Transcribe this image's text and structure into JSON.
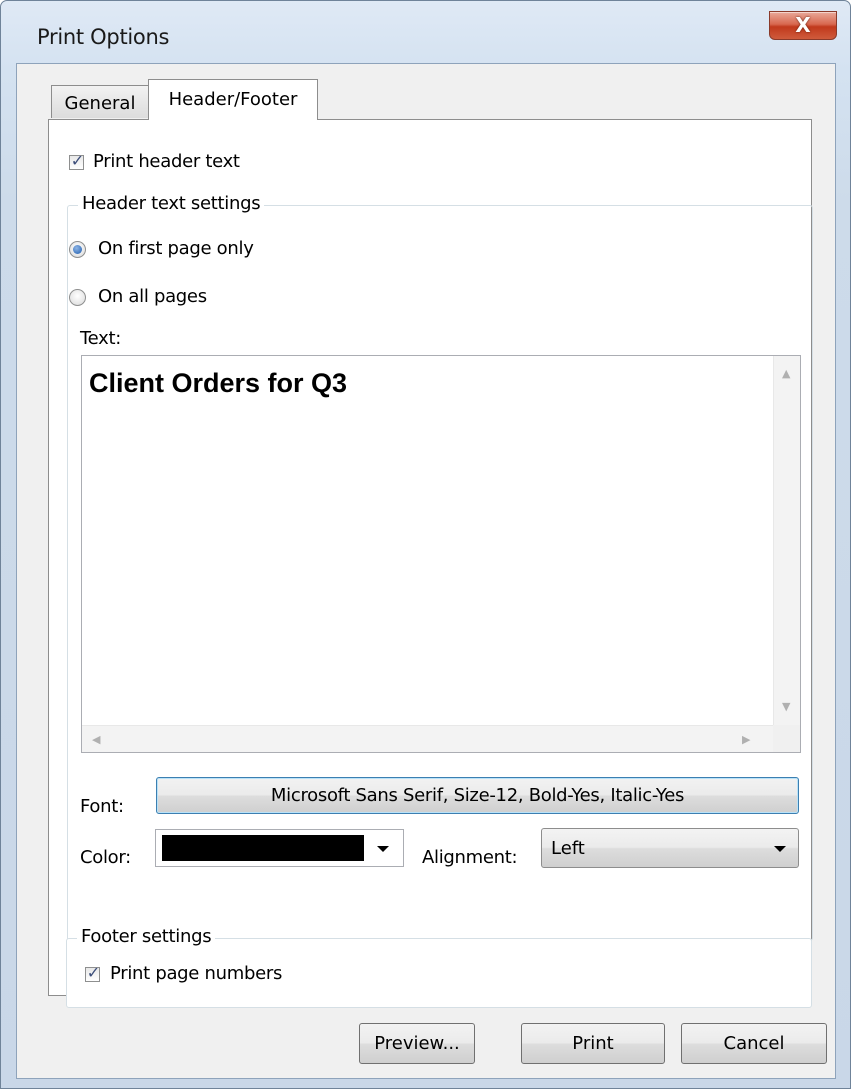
{
  "window": {
    "title": "Print Options",
    "close_glyph": "X"
  },
  "tabs": [
    {
      "label": "General",
      "selected": false
    },
    {
      "label": "Header/Footer",
      "selected": true
    }
  ],
  "header": {
    "print_header_label": "Print header text",
    "print_header_checked": true,
    "group_title": "Header text settings",
    "radio_first_label": "On first page only",
    "radio_first_selected": true,
    "radio_all_label": "On all pages",
    "radio_all_selected": false,
    "text_label": "Text:",
    "text_value": "Client Orders for Q3",
    "font_label": "Font:",
    "font_value": "Microsoft Sans Serif, Size-12, Bold-Yes, Italic-Yes",
    "color_label": "Color:",
    "color_value": "#000000",
    "alignment_label": "Alignment:",
    "alignment_value": "Left"
  },
  "footer": {
    "group_title": "Footer settings",
    "print_page_numbers_label": "Print page numbers",
    "print_page_numbers_checked": true
  },
  "buttons": {
    "preview": "Preview...",
    "print": "Print",
    "cancel": "Cancel"
  },
  "icons": {
    "check": "✓",
    "scroll_up": "▲",
    "scroll_down": "▼",
    "scroll_left": "◀",
    "scroll_right": "▶"
  }
}
